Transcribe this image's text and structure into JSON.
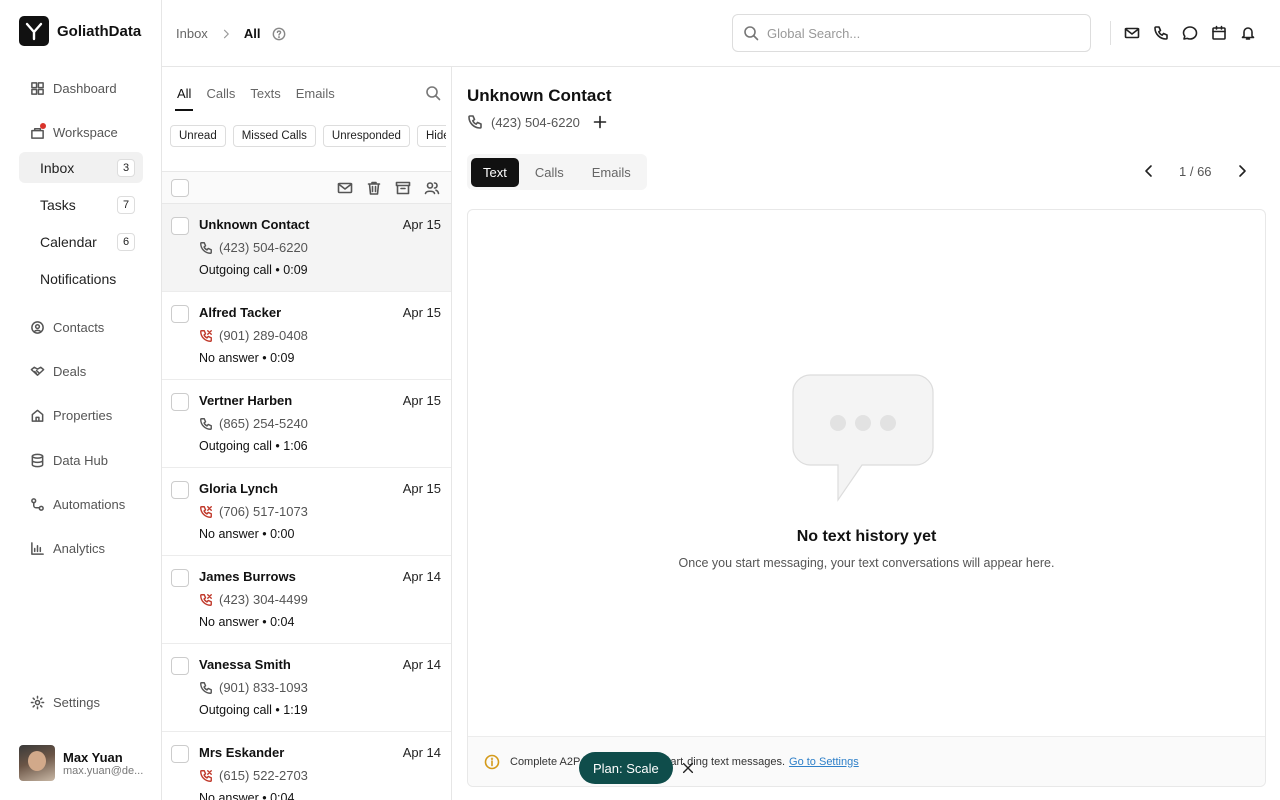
{
  "app": {
    "name": "GoliathData"
  },
  "sidebar": {
    "nav": {
      "dashboard": "Dashboard",
      "workspace": "Workspace",
      "contacts": "Contacts",
      "deals": "Deals",
      "properties": "Properties",
      "data_hub": "Data Hub",
      "automations": "Automations",
      "analytics": "Analytics",
      "settings": "Settings"
    },
    "workspace_items": [
      {
        "label": "Inbox",
        "count": "3"
      },
      {
        "label": "Tasks",
        "count": "7"
      },
      {
        "label": "Calendar",
        "count": "6"
      },
      {
        "label": "Notifications",
        "count": ""
      }
    ],
    "user": {
      "name": "Max Yuan",
      "email": "max.yuan@de..."
    }
  },
  "header": {
    "breadcrumb": [
      "Inbox",
      "All"
    ],
    "search_placeholder": "Global Search..."
  },
  "list": {
    "tabs": [
      "All",
      "Calls",
      "Texts",
      "Emails"
    ],
    "filters": [
      "Unread",
      "Missed Calls",
      "Unresponded",
      "Hide A"
    ],
    "rows": [
      {
        "name": "Unknown Contact",
        "date": "Apr 15",
        "phone": "(423) 504-6220",
        "summary": "Outgoing call • 0:09",
        "missed": false
      },
      {
        "name": "Alfred Tacker",
        "date": "Apr 15",
        "phone": "(901) 289-0408",
        "summary": "No answer • 0:09",
        "missed": true
      },
      {
        "name": "Vertner Harben",
        "date": "Apr 15",
        "phone": "(865) 254-5240",
        "summary": "Outgoing call • 1:06",
        "missed": false
      },
      {
        "name": "Gloria Lynch",
        "date": "Apr 15",
        "phone": "(706) 517-1073",
        "summary": "No answer • 0:00",
        "missed": true
      },
      {
        "name": "James Burrows",
        "date": "Apr 14",
        "phone": "(423) 304-4499",
        "summary": "No answer • 0:04",
        "missed": true
      },
      {
        "name": "Vanessa Smith",
        "date": "Apr 14",
        "phone": "(901) 833-1093",
        "summary": "Outgoing call • 1:19",
        "missed": false
      },
      {
        "name": "Mrs Eskander",
        "date": "Apr 14",
        "phone": "(615) 522-2703",
        "summary": "No answer • 0:04",
        "missed": true
      }
    ]
  },
  "detail": {
    "title": "Unknown Contact",
    "phone": "(423) 504-6220",
    "tabs": [
      "Text",
      "Calls",
      "Emails"
    ],
    "pager": "1 / 66",
    "empty_title": "No text history yet",
    "empty_sub": "Once you start messaging, your text conversations will appear here.",
    "banner_text_a": "Complete A2P",
    "banner_text_b": "art",
    "banner_text_c": "ding text messages.",
    "banner_link": "Go to Settings"
  },
  "plan_badge": "Plan: Scale",
  "colors": {
    "plan_bg": "#0f4d4b",
    "missed": "#c0392b",
    "link": "#2f80c9"
  }
}
